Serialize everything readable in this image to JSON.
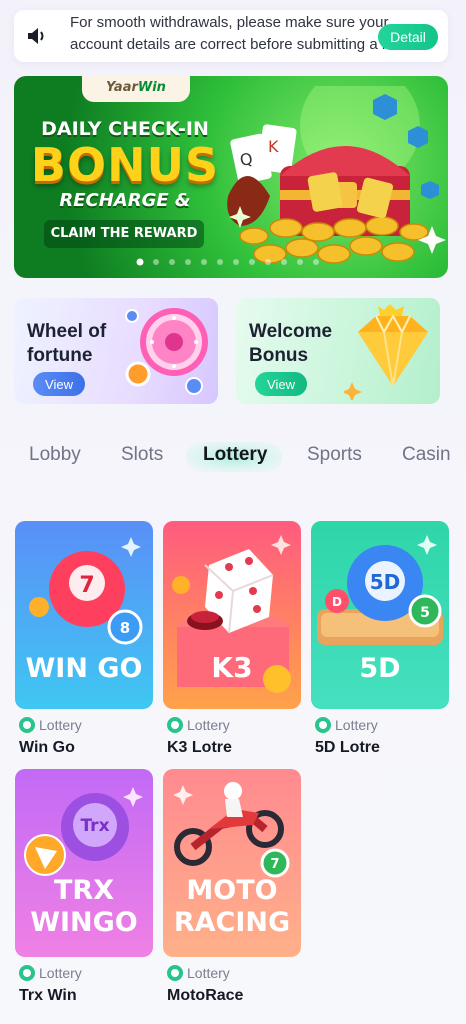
{
  "notice": {
    "line1": "For smooth withdrawals, please make sure your",
    "line2": "account details are correct before submitting a r",
    "detail_label": "Detail"
  },
  "banner": {
    "logo_left": "Yaar",
    "logo_right": "Win",
    "line1": "DAILY CHECK-IN",
    "line2": "BONUS",
    "line3": "RECHARGE &",
    "line4": "CLAIM THE REWARD",
    "slide_count": 12,
    "active_slide": 0
  },
  "promos": [
    {
      "title_line1": "Wheel of",
      "title_line2": "fortune",
      "button": "View"
    },
    {
      "title_line1": "Welcome",
      "title_line2": "Bonus",
      "button": "View"
    }
  ],
  "tabs": {
    "items": [
      "Lobby",
      "Slots",
      "Lottery",
      "Sports",
      "Casin"
    ],
    "active": "Lottery"
  },
  "games": [
    {
      "category": "Lottery",
      "name": "Win Go",
      "art_text": "WIN GO",
      "ball_label": "7",
      "small_ball_label": "8"
    },
    {
      "category": "Lottery",
      "name": "K3 Lotre",
      "art_text": "K3"
    },
    {
      "category": "Lottery",
      "name": "5D Lotre",
      "art_text": "5D",
      "ball_label": "5D",
      "small_ball_label": "5",
      "left_ball_label": "D"
    },
    {
      "category": "Lottery",
      "name": "Trx Win",
      "art_text_line1": "TRX",
      "art_text_line2": "WINGO",
      "ball_label": "Trx"
    },
    {
      "category": "Lottery",
      "name": "MotoRace",
      "art_text_line1": "MOTO",
      "art_text_line2": "RACING",
      "ball_label": "7"
    }
  ],
  "colors": {
    "accent_green": "#1ccc91",
    "view_blue": "#4a7cf0",
    "tab_active": "#14171f",
    "tab_inactive": "#6f7585"
  }
}
